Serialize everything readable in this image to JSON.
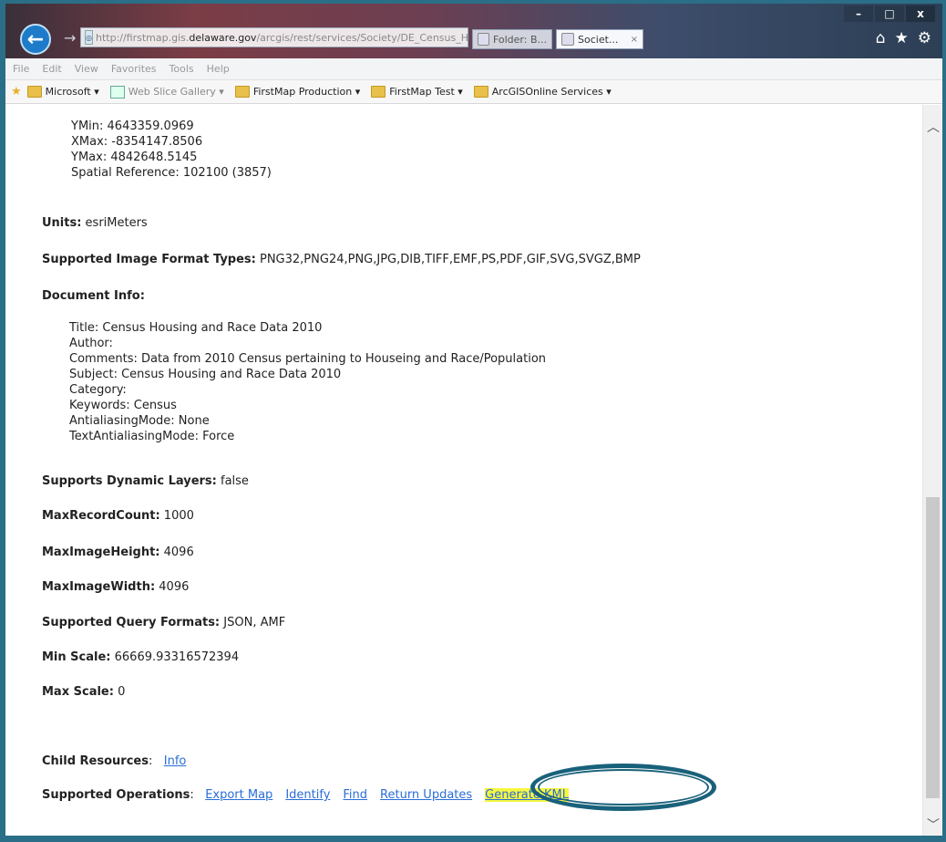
{
  "browser": {
    "address_url_prefix": "http://firstmap.gis.",
    "address_domain": "delaware.gov",
    "address_url_suffix": "/arcgis/rest/services/Society/DE_Census_Housing_Race/Ma",
    "search_icon": "⌕",
    "refresh_icon": "↻",
    "tabs": [
      {
        "label": "Folder: B...",
        "active": false
      },
      {
        "label": "Societ...",
        "active": true
      }
    ],
    "tab_close": "×",
    "window_buttons": {
      "minimize": "–",
      "maximize": "□",
      "close": "x"
    },
    "back_glyph": "←",
    "forward_glyph": "→",
    "toolbar_icons": {
      "home": "⌂",
      "favorites": "★",
      "settings": "⚙"
    }
  },
  "menu": [
    "File",
    "Edit",
    "View",
    "Favorites",
    "Tools",
    "Help"
  ],
  "favorites": [
    {
      "label": "Microsoft ▾",
      "type": "folder"
    },
    {
      "label": "Web Slice Gallery ▾",
      "type": "slice"
    },
    {
      "label": "FirstMap Production ▾",
      "type": "folder"
    },
    {
      "label": "FirstMap Test ▾",
      "type": "folder"
    },
    {
      "label": "ArcGISOnline Services ▾",
      "type": "folder"
    }
  ],
  "extent": {
    "ymin": "YMin: 4643359.0969",
    "xmax": "XMax: -8354147.8506",
    "ymax": "YMax: 4842648.5145",
    "spatial_ref": "Spatial Reference: 102100  (3857)"
  },
  "units": {
    "label": "Units:",
    "value": " esriMeters"
  },
  "image_formats": {
    "label": "Supported Image Format Types:",
    "value": " PNG32,PNG24,PNG,JPG,DIB,TIFF,EMF,PS,PDF,GIF,SVG,SVGZ,BMP"
  },
  "document_info": {
    "label": "Document Info:",
    "lines": [
      "Title: Census Housing and Race Data 2010",
      "Author:",
      "Comments: Data from 2010 Census pertaining to Houseing and Race/Population",
      "Subject: Census Housing and Race Data 2010",
      "Category:",
      "Keywords: Census",
      "AntialiasingMode: None",
      "TextAntialiasingMode: Force"
    ]
  },
  "dynamic_layers": {
    "label": "Supports Dynamic Layers:",
    "value": " false"
  },
  "max_record_count": {
    "label": "MaxRecordCount:",
    "value": " 1000"
  },
  "max_image_height": {
    "label": "MaxImageHeight:",
    "value": " 4096"
  },
  "max_image_width": {
    "label": "MaxImageWidth:",
    "value": " 4096"
  },
  "query_formats": {
    "label": "Supported Query Formats:",
    "value": " JSON, AMF"
  },
  "min_scale": {
    "label": "Min Scale:",
    "value": " 66669.93316572394"
  },
  "max_scale": {
    "label": "Max Scale:",
    "value": " 0"
  },
  "child_resources": {
    "label": "Child Resources",
    "sep": ":",
    "link": "Info"
  },
  "operations": {
    "label": "Supported Operations",
    "sep": ":",
    "links": [
      "Export Map",
      "Identify",
      "Find",
      "Return Updates",
      "Generate KML"
    ]
  },
  "colors": {
    "link": "#2a6dd8",
    "highlight": "#f7f740",
    "annotation": "#19617a"
  }
}
